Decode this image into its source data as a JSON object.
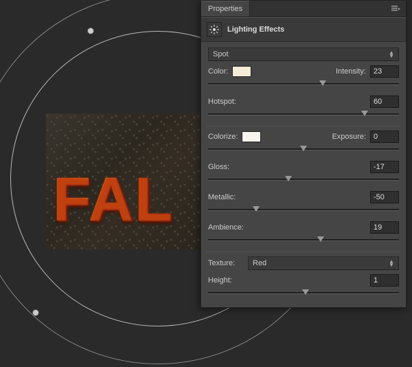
{
  "panel": {
    "tab_label": "Properties",
    "title": "Lighting Effects",
    "light_type": {
      "selected": "Spot"
    },
    "color": {
      "label": "Color:",
      "swatch": "#f5ecd6"
    },
    "intensity": {
      "label": "Intensity:",
      "value": "23",
      "slider_pct": 60
    },
    "hotspot": {
      "label": "Hotspot:",
      "value": "60",
      "slider_pct": 82
    },
    "colorize": {
      "label": "Colorize:",
      "swatch": "#f7f4ee"
    },
    "exposure": {
      "label": "Exposure:",
      "value": "0",
      "slider_pct": 50
    },
    "gloss": {
      "label": "Gloss:",
      "value": "-17",
      "slider_pct": 42
    },
    "metallic": {
      "label": "Metallic:",
      "value": "-50",
      "slider_pct": 25
    },
    "ambience": {
      "label": "Ambience:",
      "value": "19",
      "slider_pct": 59
    },
    "texture": {
      "label": "Texture:",
      "selected": "Red"
    },
    "height": {
      "label": "Height:",
      "value": "1",
      "slider_pct": 51
    }
  },
  "canvas": {
    "text": "FAL"
  }
}
